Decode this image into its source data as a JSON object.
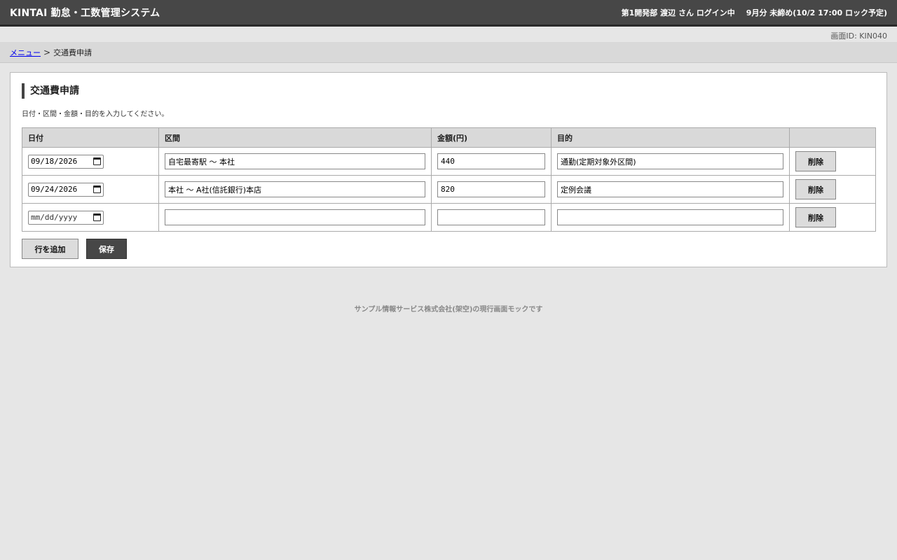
{
  "header": {
    "app_title": "KINTAI 勤怠・工数管理システム",
    "user_info": "第1開発部 渡辺 さん ログイン中",
    "period_status": "9月分 未締め(10/2 17:00 ロック予定)"
  },
  "screen_id": "画面ID: KIN040",
  "breadcrumb": {
    "menu_link": "メニュー",
    "separator": ">",
    "current": "交通費申請"
  },
  "form": {
    "title": "交通費申請",
    "description": "日付・区間・金額・目的を入力してください。",
    "columns": [
      "日付",
      "区間",
      "金額(円)",
      "目的",
      ""
    ],
    "rows": [
      {
        "date": "09/18/2026",
        "section": "自宅最寄駅 〜 本社",
        "amount": "440",
        "purpose": "通勤(定期対象外区間)",
        "delete_label": "削除"
      },
      {
        "date": "09/24/2026",
        "section": "本社 〜 A社(信託銀行)本店",
        "amount": "820",
        "purpose": "定例会議",
        "delete_label": "削除"
      },
      {
        "date": "mm/dd/yyyy",
        "section": "",
        "amount": "",
        "purpose": "",
        "delete_label": "削除"
      }
    ],
    "add_row_label": "行を追加",
    "save_label": "保存"
  },
  "footer": "サンプル情報サービス株式会社(架空)の現行画面モックです",
  "colors": {
    "topbar": "#474747",
    "background": "#e6e6e6",
    "save_button": "#474747",
    "link": "#0000ee"
  },
  "icons": [
    "calendar-icon"
  ]
}
